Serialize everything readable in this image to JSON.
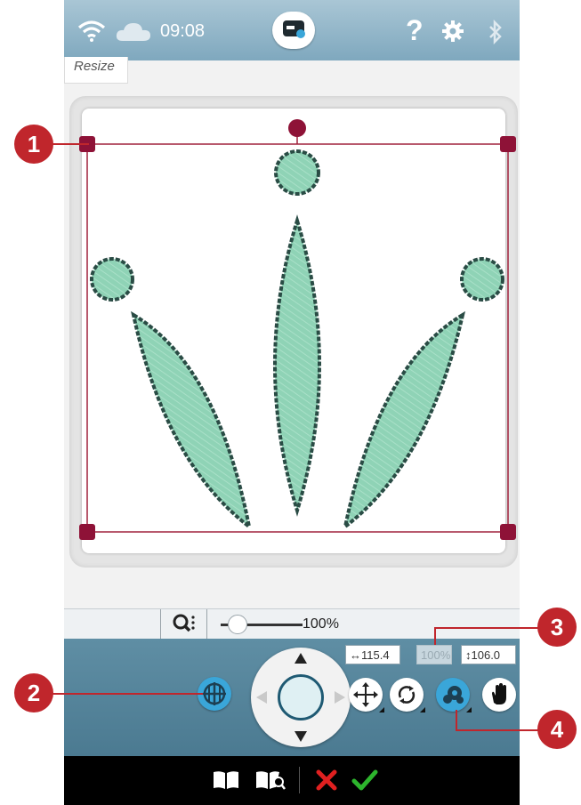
{
  "status_bar": {
    "time": "09:08",
    "icons": [
      "wifi-icon",
      "cloud-icon",
      "machine-logo-icon",
      "help-icon",
      "gear-icon",
      "bluetooth-icon"
    ],
    "help_label": "?"
  },
  "window": {
    "title": "Resize"
  },
  "canvas": {
    "design_fill": "#8fd3b6",
    "design_stroke": "#2a4c45",
    "frame_color": "#a0223d"
  },
  "zoom": {
    "icon": "zoom-menu-icon",
    "value": "100%"
  },
  "controls": {
    "width_value": "↔115.4",
    "scale_value": "100%",
    "height_value": "↕106.0",
    "buttons": [
      "placement-grid-icon",
      "move-icon",
      "rotate-icon",
      "resize-icon",
      "pan-hand-icon"
    ]
  },
  "bottom_bar": {
    "icons": [
      "help-book-icon",
      "quick-help-icon",
      "cancel-icon",
      "confirm-icon"
    ]
  },
  "callouts": [
    "1",
    "2",
    "3",
    "4"
  ],
  "colors": {
    "accent_blue": "#3aa6d9",
    "callout_red": "#c0262c",
    "confirm_green": "#2db52d",
    "cancel_red": "#e02020"
  }
}
